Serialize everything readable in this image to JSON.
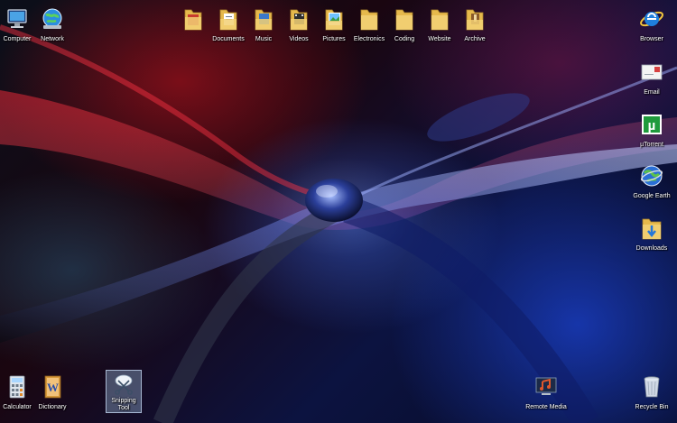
{
  "desktop": {
    "wallpaper_colors": {
      "red": "#b0101e",
      "blue": "#1c3fc4",
      "dark": "#05070d"
    },
    "top_left_icons": [
      {
        "label": "Computer",
        "icon": "computer-icon"
      },
      {
        "label": "Network",
        "icon": "network-globe-icon"
      }
    ],
    "top_folders": [
      {
        "label": "",
        "icon": "folder-icon"
      },
      {
        "label": "Documents",
        "icon": "folder-documents-icon"
      },
      {
        "label": "Music",
        "icon": "folder-music-icon"
      },
      {
        "label": "Videos",
        "icon": "folder-videos-icon"
      },
      {
        "label": "Pictures",
        "icon": "folder-pictures-icon"
      },
      {
        "label": "Electronics",
        "icon": "folder-icon"
      },
      {
        "label": "Coding",
        "icon": "folder-icon"
      },
      {
        "label": "Website",
        "icon": "folder-icon"
      },
      {
        "label": "Archive",
        "icon": "folder-archive-icon"
      }
    ],
    "right_icons": [
      {
        "label": "Browser",
        "icon": "internet-explorer-icon"
      },
      {
        "label": "Email",
        "icon": "email-icon"
      },
      {
        "label": "µTorrent",
        "icon": "utorrent-icon"
      },
      {
        "label": "Google Earth",
        "icon": "google-earth-icon"
      },
      {
        "label": "Downloads",
        "icon": "downloads-folder-icon"
      }
    ],
    "bottom_icons": [
      {
        "label": "Calculator",
        "icon": "calculator-icon"
      },
      {
        "label": "Dictionary",
        "icon": "word-icon"
      },
      {
        "label": "Snipping Tool",
        "icon": "snipping-tool-icon",
        "selected": true
      },
      {
        "label": "Remote Media",
        "icon": "remote-media-icon"
      },
      {
        "label": "Recycle Bin",
        "icon": "recycle-bin-icon"
      }
    ]
  }
}
